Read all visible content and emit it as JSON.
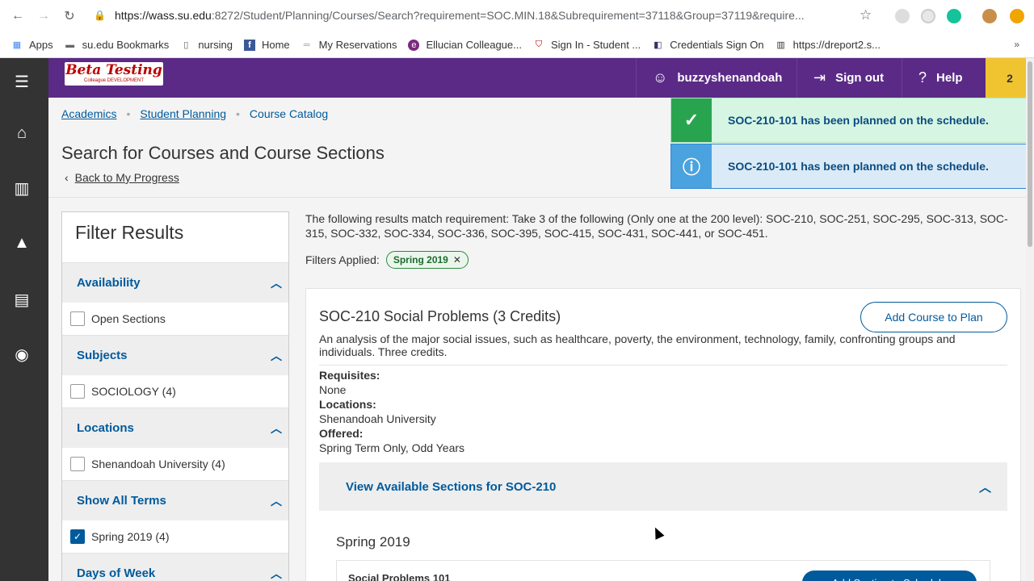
{
  "browser": {
    "url_host": "https://wass.su.edu",
    "url_rest": ":8272/Student/Planning/Courses/Search?requirement=SOC.MIN.18&Subrequirement=37118&Group=37119&require...",
    "bookmarks": [
      {
        "label": "Apps",
        "icon": "apps-grid-icon"
      },
      {
        "label": "su.edu Bookmarks",
        "icon": "folder-icon"
      },
      {
        "label": "nursing",
        "icon": "page-icon"
      },
      {
        "label": "Home",
        "icon": "facebook-icon"
      },
      {
        "label": "My Reservations",
        "icon": "reservations-icon"
      },
      {
        "label": "Ellucian Colleague...",
        "icon": "ellucian-icon"
      },
      {
        "label": "Sign In - Student ...",
        "icon": "shield-icon"
      },
      {
        "label": "Credentials Sign On",
        "icon": "credentials-icon"
      },
      {
        "label": "https://dreport2.s...",
        "icon": "chart-icon"
      }
    ],
    "more": "»"
  },
  "app": {
    "logo_main": "Beta Testing",
    "logo_sub": "Colleague DEVELOPMENT",
    "user": "buzzyshenandoah",
    "signout": "Sign out",
    "help": "Help",
    "badge": "2"
  },
  "breadcrumbs": [
    "Academics",
    "Student Planning",
    "Course Catalog"
  ],
  "page": {
    "title": "Search for Courses and Course Sections",
    "back": "Back to My Progress"
  },
  "notifications": [
    {
      "type": "success",
      "text": "SOC-210-101 has been planned on the schedule."
    },
    {
      "type": "info",
      "text": "SOC-210-101 has been planned on the schedule."
    }
  ],
  "filter": {
    "title": "Filter Results",
    "groups": [
      {
        "label": "Availability",
        "items": [
          {
            "label": "Open Sections",
            "checked": false
          }
        ]
      },
      {
        "label": "Subjects",
        "items": [
          {
            "label": "SOCIOLOGY (4)",
            "checked": false
          }
        ]
      },
      {
        "label": "Locations",
        "items": [
          {
            "label": "Shenandoah University (4)",
            "checked": false
          }
        ]
      },
      {
        "label": "Show All Terms",
        "items": [
          {
            "label": "Spring 2019 (4)",
            "checked": true
          }
        ]
      },
      {
        "label": "Days of Week",
        "items": []
      }
    ]
  },
  "results": {
    "requirement": "The following results match requirement: Take 3 of the following (Only one at the 200 level): SOC-210, SOC-251, SOC-295, SOC-313, SOC-315, SOC-332, SOC-334, SOC-336, SOC-395, SOC-415, SOC-431, SOC-441, or SOC-451.",
    "filters_label": "Filters Applied:",
    "filter_pill": "Spring 2019",
    "course": {
      "title": "SOC-210 Social Problems (3 Credits)",
      "add_button": "Add Course to Plan",
      "description": "An analysis of the major social issues, such as healthcare, poverty, the environment, technology, family, confronting groups and individuals. Three credits.",
      "requisites_label": "Requisites:",
      "requisites": "None",
      "locations_label": "Locations:",
      "locations": "Shenandoah University",
      "offered_label": "Offered:",
      "offered": "Spring Term Only, Odd Years",
      "sections_toggle": "View Available Sections for SOC-210",
      "term": "Spring 2019",
      "section_title": "Social Problems 101",
      "section_button": "Add Section to Schedule"
    }
  }
}
